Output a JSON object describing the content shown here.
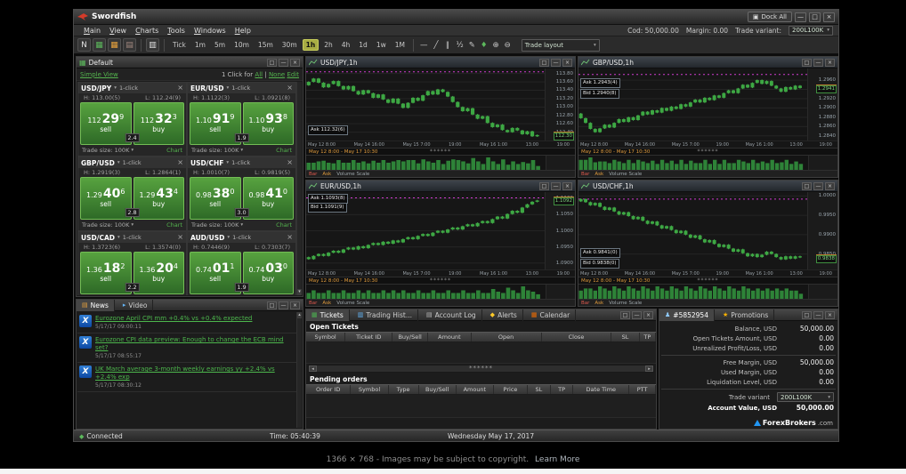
{
  "icons": {
    "close": "×",
    "minimize": "—",
    "restore": "□",
    "caret_down": "▾",
    "caret_up": "▴",
    "left": "◂",
    "right": "▸",
    "news": "N",
    "grid": "▦",
    "calendar": "▦",
    "market": "▤",
    "chart_mode": "▥",
    "line": "—",
    "trend": "╱",
    "channel": "∥",
    "fib": "½",
    "draw": "✎",
    "lab": "♦",
    "zoom_in": "⊕",
    "zoom_out": "⊖",
    "star": "★",
    "person": "♟",
    "bell": "◆",
    "page": "▤",
    "hist": "▥",
    "table": "▦",
    "video": "▸",
    "news_tab": "▤",
    "connected": "◆",
    "dock": "▣"
  },
  "titlebar": {
    "app_title": "Swordfish",
    "dock_all": "Dock All"
  },
  "menu": {
    "items": [
      "Main",
      "View",
      "Charts",
      "Tools",
      "Windows",
      "Help"
    ]
  },
  "account_strip": {
    "cod": "Cod: 50,000.00",
    "margin": "Margin: 0.00",
    "trade_variant_label": "Trade variant:",
    "trade_variant_value": "200L100K"
  },
  "toolbar": {
    "timeframes": [
      "Tick",
      "1m",
      "5m",
      "10m",
      "15m",
      "30m",
      "1h",
      "2h",
      "4h",
      "1d",
      "1w",
      "1M"
    ],
    "active_timeframe": "1h",
    "trade_layout": "Trade layout"
  },
  "ui": {
    "scroll_dots": "******"
  },
  "quotes": {
    "title": "Default",
    "simple_view": "Simple View",
    "click_bar": {
      "prefix": "1 Click for",
      "all": "All",
      "sep": "|",
      "none": "None",
      "edit": "Edit"
    },
    "labels": {
      "one_click": "1-click",
      "sell": "sell",
      "buy": "buy",
      "trade_size": "Trade size:",
      "chart": "Chart"
    },
    "tiles": [
      {
        "pair": "USD/JPY",
        "high": "H: 113.00(5)",
        "low": "L: 112.24(9)",
        "sell": {
          "prefix": "112",
          "main": "29",
          "sup": "9"
        },
        "buy": {
          "prefix": "112",
          "main": "32",
          "sup": "3"
        },
        "spread": "2.4",
        "size": "100K"
      },
      {
        "pair": "EUR/USD",
        "high": "H: 1.1122(3)",
        "low": "L: 1.0921(8)",
        "sell": {
          "prefix": "1.10",
          "main": "91",
          "sup": "9"
        },
        "buy": {
          "prefix": "1.10",
          "main": "93",
          "sup": "8"
        },
        "spread": "1.9",
        "size": "100K"
      },
      {
        "pair": "GBP/USD",
        "high": "H: 1.2919(3)",
        "low": "L: 1.2864(1)",
        "sell": {
          "prefix": "1.29",
          "main": "40",
          "sup": "6"
        },
        "buy": {
          "prefix": "1.29",
          "main": "43",
          "sup": "4"
        },
        "spread": "2.8",
        "size": "100K"
      },
      {
        "pair": "USD/CHF",
        "high": "H: 1.0010(7)",
        "low": "L: 0.9819(5)",
        "sell": {
          "prefix": "0.98",
          "main": "38",
          "sup": "0"
        },
        "buy": {
          "prefix": "0.98",
          "main": "41",
          "sup": "0"
        },
        "spread": "3.0",
        "size": "100K"
      },
      {
        "pair": "USD/CAD",
        "high": "H: 1.3723(6)",
        "low": "L: 1.3574(0)",
        "sell": {
          "prefix": "1.36",
          "main": "18",
          "sup": "2"
        },
        "buy": {
          "prefix": "1.36",
          "main": "20",
          "sup": "4"
        },
        "spread": "2.2",
        "size": "100K"
      },
      {
        "pair": "AUD/USD",
        "high": "H: 0.7446(9)",
        "low": "L: 0.7303(7)",
        "sell": {
          "prefix": "0.74",
          "main": "01",
          "sup": "1"
        },
        "buy": {
          "prefix": "0.74",
          "main": "03",
          "sup": "0"
        },
        "spread": "1.9",
        "size": "100K"
      }
    ]
  },
  "chart_footer": {
    "bar": "Bar",
    "ask": "Ask",
    "volume": "Volume Scale"
  },
  "charts": [
    {
      "title": "USD/JPY,1h",
      "ask_text": "Ask 112.32(6)",
      "bid_text": "",
      "ask_value": 112.326,
      "bid_value": 112.299,
      "ask_axis": "112.32",
      "bid_axis": "112.30",
      "ylim": [
        112.2,
        113.92
      ],
      "alert": 113.84,
      "ticks": [
        "113.80",
        "113.60",
        "113.40",
        "113.20",
        "113.00",
        "112.80",
        "112.60",
        "112.40"
      ],
      "x_labels": [
        "May 12 8:00",
        "May 14 16:00",
        "May 15 7:00",
        "19:00",
        "May 16 1:00",
        "13:00",
        "19:00"
      ],
      "range_text": "May 12 8:00 - May 17 10:30",
      "values": [
        113.52,
        113.6,
        113.68,
        113.58,
        113.47,
        113.55,
        113.62,
        113.5,
        113.42,
        113.5,
        113.38,
        113.3,
        113.4,
        113.33,
        113.22,
        113.3,
        113.18,
        113.1,
        113.2,
        113.08,
        112.98,
        113.1,
        113.22,
        113.15,
        113.28,
        113.38,
        113.3,
        113.42,
        113.36,
        113.25,
        113.12,
        113.0,
        112.9,
        112.97,
        112.82,
        112.72,
        112.78,
        112.62,
        112.52,
        112.58,
        112.45,
        112.4,
        112.5,
        112.44,
        112.35,
        112.42,
        112.3,
        112.33
      ]
    },
    {
      "title": "GBP/USD,1h",
      "ask_text": "Ask 1.2943(4)",
      "bid_text": "Bid 1.2940(8)",
      "ask_value": 1.29434,
      "bid_value": 1.29408,
      "ask_axis": "1.2943",
      "bid_axis": "1.2941",
      "ylim": [
        1.283,
        1.2985
      ],
      "alert": 1.2972,
      "ticks": [
        "1.2960",
        "1.2940",
        "1.2920",
        "1.2900",
        "1.2880",
        "1.2860",
        "1.2840"
      ],
      "x_labels": [
        "May 12 8:00",
        "May 14 16:00",
        "May 15 7:00",
        "19:00",
        "May 16 1:00",
        "13:00",
        "19:00"
      ],
      "range_text": "May 12 8:00 - May 17 10:30",
      "values": [
        1.2888,
        1.2878,
        1.2868,
        1.2855,
        1.2848,
        1.2856,
        1.2864,
        1.2858,
        1.2868,
        1.2876,
        1.287,
        1.288,
        1.2874,
        1.2884,
        1.2892,
        1.2886,
        1.2895,
        1.289,
        1.29,
        1.2894,
        1.2903,
        1.2898,
        1.2908,
        1.2903,
        1.2912,
        1.2918,
        1.2912,
        1.2922,
        1.2917,
        1.2927,
        1.2922,
        1.2932,
        1.2938,
        1.2932,
        1.2942,
        1.295,
        1.2944,
        1.2954,
        1.296,
        1.2952,
        1.2958,
        1.2948,
        1.2942,
        1.2935,
        1.2945,
        1.294,
        1.2948,
        1.2943
      ]
    },
    {
      "title": "EUR/USD,1h",
      "ask_text": "Ask 1.1093(8)",
      "bid_text": "Bid 1.1091(9)",
      "ask_value": 1.10938,
      "bid_value": 1.10919,
      "ask_axis": "1.1094",
      "bid_axis": "1.1092",
      "ylim": [
        1.088,
        1.112
      ],
      "alert": 1.1102,
      "ticks": [
        "1.1100",
        "1.1050",
        "1.1000",
        "1.0950",
        "1.0900"
      ],
      "x_labels": [
        "May 12 8:00",
        "May 14 16:00",
        "May 15 7:00",
        "19:00",
        "May 16 1:00",
        "13:00",
        "19:00"
      ],
      "range_text": "May 12 8:00 - May 17 10:30",
      "values": [
        1.0918,
        1.0912,
        1.0922,
        1.0928,
        1.0922,
        1.0932,
        1.0938,
        1.0932,
        1.0942,
        1.0948,
        1.0942,
        1.0952,
        1.0946,
        1.0956,
        1.0962,
        1.0956,
        1.0966,
        1.096,
        1.097,
        1.0964,
        1.0974,
        1.098,
        1.0974,
        1.0984,
        1.099,
        1.0984,
        1.0994,
        1.1,
        1.0994,
        1.1004,
        1.101,
        1.1004,
        1.1014,
        1.102,
        1.1014,
        1.1024,
        1.103,
        1.1024,
        1.1036,
        1.1044,
        1.1038,
        1.1052,
        1.1062,
        1.1056,
        1.1072,
        1.1082,
        1.109,
        1.1094
      ]
    },
    {
      "title": "USD/CHF,1h",
      "ask_text": "Ask 0.9841(0)",
      "bid_text": "Bid 0.9838(0)",
      "ask_value": 0.9841,
      "bid_value": 0.9838,
      "ask_axis": "0.9841",
      "bid_axis": "0.9838",
      "ylim": [
        0.981,
        1.001
      ],
      "alert": 0.9992,
      "ticks": [
        "1.0000",
        "0.9950",
        "0.9900",
        "0.9850"
      ],
      "x_labels": [
        "May 12 8:00",
        "May 14 16:00",
        "May 15 7:00",
        "19:00",
        "May 16 1:00",
        "13:00",
        "19:00"
      ],
      "range_text": "May 12 8:00 - May 17 10:30",
      "values": [
        0.9986,
        0.9992,
        0.9984,
        0.9976,
        0.9982,
        0.9972,
        0.9964,
        0.997,
        0.996,
        0.9952,
        0.9958,
        0.9948,
        0.994,
        0.9946,
        0.9936,
        0.9928,
        0.9934,
        0.9924,
        0.9916,
        0.9922,
        0.9912,
        0.9904,
        0.991,
        0.99,
        0.9892,
        0.9898,
        0.9888,
        0.988,
        0.9886,
        0.9876,
        0.9868,
        0.9874,
        0.9864,
        0.9856,
        0.9862,
        0.9852,
        0.9844,
        0.985,
        0.9842,
        0.9848,
        0.9856,
        0.985,
        0.9842,
        0.9836,
        0.9844,
        0.9838,
        0.9844,
        0.9841
      ]
    }
  ],
  "news": {
    "tabs": [
      "News",
      "Video"
    ],
    "items": [
      {
        "headline": "Eurozone April CPI mm +0.4% vs +0.4% expected",
        "time": "5/17/17 09:00:11"
      },
      {
        "headline": "Eurozone CPI data preview: Enough to change the ECB mind set?",
        "time": "5/17/17 08:55:17"
      },
      {
        "headline": "UK March average 3-month weekly earnings yy +2.4% vs +2.4% exp",
        "time": "5/17/17 08:30:12"
      }
    ]
  },
  "tickets": {
    "tabs": [
      "Tickets",
      "Trading Hist...",
      "Account Log",
      "Alerts",
      "Calendar"
    ],
    "open_label": "Open Tickets",
    "open_columns": [
      "Symbol",
      "Ticket ID",
      "Buy/Sell",
      "Amount",
      "Open",
      "Close",
      "SL",
      "TP"
    ],
    "pending_label": "Pending orders",
    "pending_columns": [
      "Order ID",
      "Symbol",
      "Type",
      "Buy/Sell",
      "Amount",
      "Price",
      "SL",
      "TP",
      "Date Time",
      "PTT"
    ]
  },
  "account": {
    "tabs": [
      "#5852954",
      "Promotions"
    ],
    "rows": [
      {
        "label": "Balance, USD",
        "value": "50,000.00"
      },
      {
        "label": "Open Tickets Amount, USD",
        "value": "0.00"
      },
      {
        "label": "Unrealized Profit/Loss, USD",
        "value": "0.00"
      },
      {
        "label": "Free Margin, USD",
        "value": "50,000.00"
      },
      {
        "label": "Used Margin, USD",
        "value": "0.00"
      },
      {
        "label": "Liquidation Level, USD",
        "value": "0.00"
      }
    ],
    "trade_variant": {
      "label": "Trade variant",
      "value": "200L100K"
    },
    "account_value": {
      "label": "Account Value, USD",
      "value": "50,000.00"
    },
    "logo": {
      "name": "ForexBrokers",
      "tld": ".com"
    }
  },
  "statusbar": {
    "connected": "Connected",
    "time": "Time: 05:40:39",
    "date": "Wednesday May 17, 2017"
  },
  "caption": {
    "dimensions": "1366 × 768",
    "text": "- Images may be subject to copyright.",
    "link": "Learn More"
  }
}
